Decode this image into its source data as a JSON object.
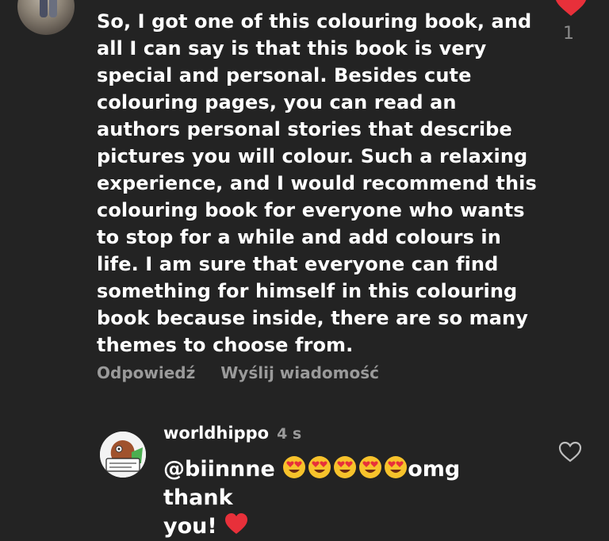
{
  "comment": {
    "text": "So, I got one of this colouring book, and all I can say is that this book is very special and personal. Besides cute colouring pages, you can read an authors personal stories that describe pictures you will colour. Such a relaxing experience, and I would recommend this colouring book for everyone who wants to stop for a while and add colours in life. I am sure that everyone can find something for himself in this colouring book because inside, there are so many themes to choose from.",
    "like_count": "1",
    "reply_label": "Odpowiedź",
    "message_label": "Wyślij wiadomość"
  },
  "reply": {
    "username": "worldhippo",
    "time": "4 s",
    "mention": "@biinnne",
    "text_after_emojis": "omg thank",
    "text_second_line": "you!"
  },
  "colors": {
    "background": "#232323",
    "like_red": "#e8303a",
    "muted_text": "#9a9a9a"
  },
  "icons": {
    "top_like": "heart-filled-icon",
    "reply_like": "heart-outline-icon",
    "emoji": "heart-eyes-emoji",
    "red_heart": "red-heart-emoji"
  }
}
